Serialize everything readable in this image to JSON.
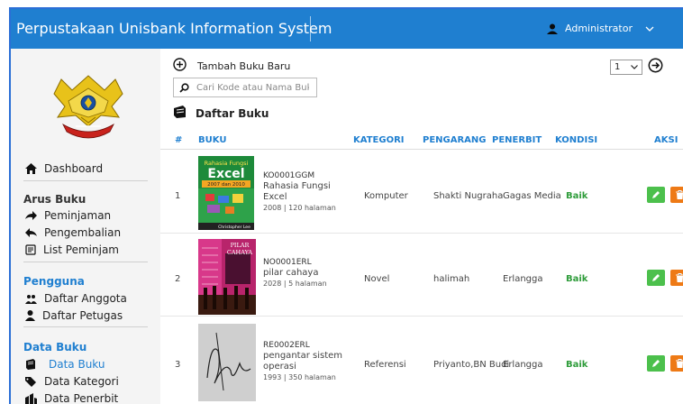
{
  "app": {
    "title": "Perpustakaan Unisbank Information System"
  },
  "header": {
    "user_name": "Administrator"
  },
  "sidebar": {
    "dashboard": "Dashboard",
    "arus_buku": {
      "title": "Arus Buku",
      "items": [
        "Peminjaman",
        "Pengembalian",
        "List Peminjam"
      ]
    },
    "pengguna": {
      "title": "Pengguna",
      "items": [
        "Daftar Anggota",
        "Daftar Petugas"
      ]
    },
    "data_buku": {
      "title": "Data Buku",
      "items": [
        "Data Buku",
        "Data Kategori",
        "Data Penerbit"
      ]
    }
  },
  "main": {
    "add_label": "Tambah Buku Baru",
    "search_placeholder": "Cari Kode atau Nama Buk",
    "list_title": "Daftar Buku",
    "page_value": "1",
    "columns": [
      "#",
      "BUKU",
      "KATEGORI",
      "PENGARANG",
      "PENERBIT",
      "KONDISI",
      "AKSI"
    ],
    "rows": [
      {
        "num": "1",
        "code": "KO0001GGM",
        "title": "Rahasia Fungsi Excel",
        "meta": "2008 | 120 halaman",
        "kategori": "Komputer",
        "pengarang": "Shakti Nugraha",
        "penerbit": "Gagas Media",
        "kondisi": "Baik",
        "cover_text": {
          "line1": "Rahasia Fungsi",
          "line2": "Excel",
          "line3": "2007 dan 2010",
          "author": "Christopher Lee"
        }
      },
      {
        "num": "2",
        "code": "NO0001ERL",
        "title": "pilar cahaya",
        "meta": "2028 | 5 halaman",
        "kategori": "Novel",
        "pengarang": "halimah",
        "penerbit": "Erlangga",
        "kondisi": "Baik",
        "cover_text": {
          "line1": "PILAR",
          "line2": "CAHAYA"
        }
      },
      {
        "num": "3",
        "code": "RE0002ERL",
        "title": "pengantar sistem operasi",
        "meta": "1993 | 350 halaman",
        "kategori": "Referensi",
        "pengarang": "Priyanto,BN Budi",
        "penerbit": "Erlangga",
        "kondisi": "Baik"
      }
    ]
  },
  "colors": {
    "accent": "#1f7fd0",
    "success": "#2e9c3a",
    "edit": "#4cc04c",
    "delete": "#ee7a16"
  }
}
